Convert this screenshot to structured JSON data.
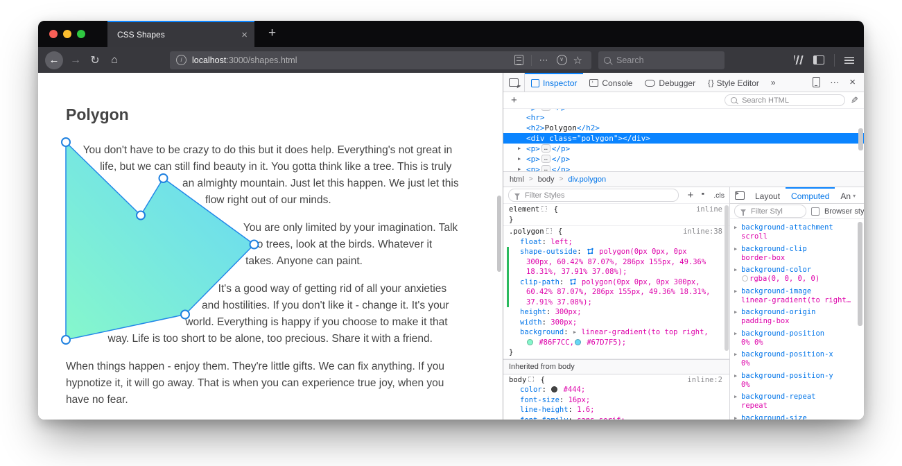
{
  "window": {
    "tab_title": "CSS Shapes",
    "url_host": "localhost",
    "url_path": ":3000/shapes.html",
    "search_placeholder": "Search"
  },
  "glyphs": {
    "close": "×",
    "new_tab": "+",
    "back": "←",
    "forward": "→",
    "reload": "↻",
    "home": "⌂",
    "meatballs": "⋯",
    "pocket_chevron": "∨",
    "star": "☆",
    "info": "i",
    "add": "+",
    "pencil": "✎",
    "more_tabs": "»",
    "braces": "{ }",
    "twisty": "▶",
    "dropdown": "▾",
    "prompt": "›"
  },
  "colors": {
    "accent_blue": "#0a84ff",
    "devtools_blue": "#0074e8",
    "css_value_magenta": "#dd00a9",
    "gutter_green": "#2bba5e",
    "selection_blue": "#0a84ff"
  },
  "page": {
    "heading": "Polygon",
    "paragraphs": [
      "You don't have to be crazy to do this but it does help. Everything's not great in life, but we can still find beauty in it. You gotta think like a tree. This is truly an almighty mountain. Just let this happen. We just let this flow right out of our minds.",
      "You are only limited by your imagination. Talk to trees, look at the birds. Whatever it takes. Anyone can paint.",
      "It's a good way of getting rid of all your anxieties and hostilities. If you don't like it - change it. It's your world. Everything is happy if you choose to make it that way. Life is too short to be alone, too precious. Share it with a friend.",
      "When things happen - enjoy them. They're little gifts. We can fix anything. If you hypnotize it, it will go away. That is when you can experience true joy, when you have no fear."
    ],
    "shape": {
      "gradient_from": "#86F7CC",
      "gradient_to": "#67D7F5"
    }
  },
  "devtools": {
    "tabs": [
      {
        "label": "Inspector",
        "active": true
      },
      {
        "label": "Console",
        "active": false
      },
      {
        "label": "Debugger",
        "active": false
      },
      {
        "label": "Style Editor",
        "active": false
      }
    ],
    "markup": {
      "search_placeholder": "Search HTML",
      "collapsed_open": "<p>",
      "collapsed_close": "</p>",
      "ellipsis": "…",
      "rows": [
        {
          "kind": "collapsed"
        },
        {
          "kind": "plain",
          "tokens": [
            {
              "k": "tag",
              "t": "<hr>"
            }
          ]
        },
        {
          "kind": "plain",
          "tokens": [
            {
              "k": "tag",
              "t": "<h2>"
            },
            {
              "k": "text",
              "t": "Polygon"
            },
            {
              "k": "tag",
              "t": "</h2>"
            }
          ]
        },
        {
          "kind": "selected",
          "text": "<div class=\"polygon\"></div>"
        },
        {
          "kind": "collapsed"
        },
        {
          "kind": "collapsed"
        },
        {
          "kind": "collapsed"
        }
      ]
    },
    "breadcrumbs": [
      {
        "label": "html",
        "active": false
      },
      {
        "label": "body",
        "active": false
      },
      {
        "label": "div.polygon",
        "active": true
      }
    ],
    "rules": {
      "filter_placeholder": "Filter Styles",
      "cls_label": ".cls",
      "inherited_label": "Inherited from body",
      "blocks": [
        {
          "lines": [
            {
              "tokens": [
                {
                  "k": "sel",
                  "t": "element"
                },
                {
                  "k": "target"
                },
                {
                  "k": "punct",
                  "t": " {"
                },
                {
                  "k": "loc",
                  "t": "inline"
                }
              ]
            },
            {
              "tokens": [
                {
                  "k": "punct",
                  "t": "}"
                }
              ]
            }
          ]
        },
        {
          "lines": [
            {
              "tokens": [
                {
                  "k": "sel",
                  "t": ".polygon"
                },
                {
                  "k": "target"
                },
                {
                  "k": "punct",
                  "t": " {"
                },
                {
                  "k": "loc",
                  "t": "inline:38"
                }
              ]
            },
            {
              "indent": 1,
              "tokens": [
                {
                  "k": "name",
                  "t": "float"
                },
                {
                  "k": "punct",
                  "t": ": "
                },
                {
                  "k": "val",
                  "t": "left;"
                }
              ]
            },
            {
              "indent": 1,
              "green": true,
              "tokens": [
                {
                  "k": "name",
                  "t": "shape-outside"
                },
                {
                  "k": "punct",
                  "t": ": "
                },
                {
                  "k": "shape"
                },
                {
                  "k": "val",
                  "t": " polygon(0px 0px, 0px"
                }
              ]
            },
            {
              "indent": 2,
              "green": true,
              "tokens": [
                {
                  "k": "val",
                  "t": "300px, 60.42% 87.07%, 286px 155px, 49.36%"
                }
              ]
            },
            {
              "indent": 2,
              "green": true,
              "tokens": [
                {
                  "k": "val",
                  "t": "18.31%, 37.91% 37.08%);"
                }
              ]
            },
            {
              "indent": 1,
              "green": true,
              "tokens": [
                {
                  "k": "name",
                  "t": "clip-path"
                },
                {
                  "k": "punct",
                  "t": ": "
                },
                {
                  "k": "shape"
                },
                {
                  "k": "val",
                  "t": " polygon(0px 0px, 0px 300px,"
                }
              ]
            },
            {
              "indent": 2,
              "green": true,
              "tokens": [
                {
                  "k": "val",
                  "t": "60.42% 87.07%, 286px 155px, 49.36% 18.31%,"
                }
              ]
            },
            {
              "indent": 2,
              "green": true,
              "tokens": [
                {
                  "k": "val",
                  "t": "37.91% 37.08%);"
                }
              ]
            },
            {
              "indent": 1,
              "tokens": [
                {
                  "k": "name",
                  "t": "height"
                },
                {
                  "k": "punct",
                  "t": ": "
                },
                {
                  "k": "val",
                  "t": "300px;"
                }
              ]
            },
            {
              "indent": 1,
              "tokens": [
                {
                  "k": "name",
                  "t": "width"
                },
                {
                  "k": "punct",
                  "t": ": "
                },
                {
                  "k": "val",
                  "t": "300px;"
                }
              ]
            },
            {
              "indent": 1,
              "tokens": [
                {
                  "k": "name",
                  "t": "background"
                },
                {
                  "k": "punct",
                  "t": ": "
                },
                {
                  "k": "arrow"
                },
                {
                  "k": "val",
                  "t": " linear-gradient(to top right,"
                }
              ]
            },
            {
              "indent": 2,
              "tokens": [
                {
                  "k": "swatch",
                  "c": "#86F7CC"
                },
                {
                  "k": "val",
                  "t": " #86F7CC,"
                },
                {
                  "k": "swatch",
                  "c": "#67D7F5"
                },
                {
                  "k": "val",
                  "t": " #67D7F5);"
                }
              ]
            },
            {
              "tokens": [
                {
                  "k": "punct",
                  "t": "}"
                }
              ]
            }
          ]
        },
        {
          "inherited": true,
          "lines": [
            {
              "tokens": [
                {
                  "k": "sel",
                  "t": "body"
                },
                {
                  "k": "target"
                },
                {
                  "k": "punct",
                  "t": " {"
                },
                {
                  "k": "loc",
                  "t": "inline:2"
                }
              ]
            },
            {
              "indent": 1,
              "tokens": [
                {
                  "k": "name",
                  "t": "color"
                },
                {
                  "k": "punct",
                  "t": ": "
                },
                {
                  "k": "swatch",
                  "c": "#444444"
                },
                {
                  "k": "val",
                  "t": " #444;"
                }
              ]
            },
            {
              "indent": 1,
              "tokens": [
                {
                  "k": "name",
                  "t": "font-size"
                },
                {
                  "k": "punct",
                  "t": ": "
                },
                {
                  "k": "val",
                  "t": "16px;"
                }
              ]
            },
            {
              "indent": 1,
              "tokens": [
                {
                  "k": "name",
                  "t": "line-height"
                },
                {
                  "k": "punct",
                  "t": ": "
                },
                {
                  "k": "val",
                  "t": "1.6;"
                }
              ]
            },
            {
              "indent": 1,
              "tokens": [
                {
                  "k": "name",
                  "t": "font-family"
                },
                {
                  "k": "punct",
                  "t": ": "
                },
                {
                  "k": "val",
                  "t": "sans-serif;"
                }
              ]
            }
          ]
        }
      ]
    },
    "sidebar": {
      "tabs": [
        {
          "label": "Layout",
          "active": false
        },
        {
          "label": "Computed",
          "active": true
        },
        {
          "label": "An",
          "active": false
        }
      ],
      "filter_placeholder": "Filter Styl",
      "browser_styles_label": "Browser styles",
      "computed": [
        {
          "name": "background-attachment",
          "value": "scroll"
        },
        {
          "name": "background-clip",
          "value": "border-box"
        },
        {
          "name": "background-color",
          "value": "rgba(0, 0, 0, 0)",
          "swatch": "transparent"
        },
        {
          "name": "background-image",
          "value": "linear-gradient(to right…"
        },
        {
          "name": "background-origin",
          "value": "padding-box"
        },
        {
          "name": "background-position",
          "value": "0% 0%"
        },
        {
          "name": "background-position-x",
          "value": "0%"
        },
        {
          "name": "background-position-y",
          "value": "0%"
        },
        {
          "name": "background-repeat",
          "value": "repeat"
        },
        {
          "name": "background-size",
          "value": ""
        }
      ]
    }
  }
}
